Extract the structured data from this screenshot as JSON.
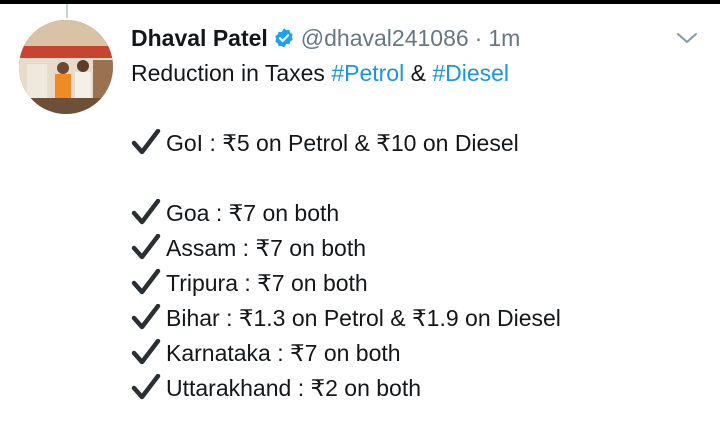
{
  "tweet": {
    "display_name": "Dhaval Patel",
    "handle": "@dhaval241086",
    "separator": "·",
    "timestamp": "1m",
    "intro_text": "Reduction in Taxes",
    "hashtag_petrol": "#Petrol",
    "amp": "&",
    "hashtag_diesel": "#Diesel",
    "items": [
      "GoI : ₹5 on Petrol & ₹10 on Diesel",
      "Goa : ₹7 on both",
      "Assam : ₹7 on both",
      "Tripura : ₹7 on both",
      "Bihar : ₹1.3 on Petrol & ₹1.9 on Diesel",
      "Karnataka : ₹7 on both",
      "Uttarakhand : ₹2 on both"
    ]
  },
  "icons": {
    "verified": "verified-badge-icon",
    "check": "heavy-check-mark-icon",
    "caret": "chevron-down-icon"
  },
  "colors": {
    "text": "#14171a",
    "muted": "#657786",
    "link": "#1b95e0",
    "verified": "#1da1f2"
  }
}
